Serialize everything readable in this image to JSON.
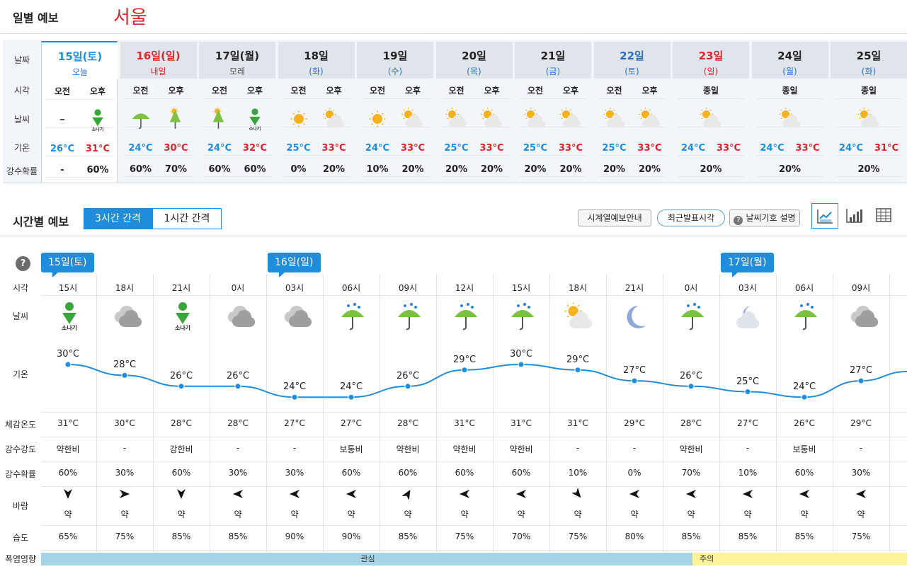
{
  "daily": {
    "title": "일별 예보",
    "city": "서울",
    "row_labels": [
      "날짜",
      "시각",
      "날씨",
      "기온",
      "강수확률"
    ],
    "days": [
      {
        "date": "15일(토)",
        "sub": "오늘",
        "tone": "blue",
        "split": true,
        "times": [
          "오전",
          "오후"
        ],
        "icons": [
          "dash",
          "shower"
        ],
        "lo": "26°C",
        "hi": "31°C",
        "prob": [
          "-",
          "60%"
        ]
      },
      {
        "date": "16일(일)",
        "sub": "내일",
        "tone": "red",
        "split": true,
        "times": [
          "오전",
          "오후"
        ],
        "icons": [
          "umbrella",
          "umbrella-sun"
        ],
        "lo": "24°C",
        "hi": "30°C",
        "prob": [
          "60%",
          "70%"
        ]
      },
      {
        "date": "17일(월)",
        "sub": "모레",
        "tone": "normal",
        "split": true,
        "times": [
          "오전",
          "오후"
        ],
        "icons": [
          "umbrella-sun",
          "shower"
        ],
        "lo": "24°C",
        "hi": "32°C",
        "prob": [
          "60%",
          "60%"
        ]
      },
      {
        "date": "18일",
        "sub": "(화)",
        "tone": "normal",
        "split": true,
        "times": [
          "오전",
          "오후"
        ],
        "icons": [
          "sun",
          "sun-cloud"
        ],
        "lo": "25°C",
        "hi": "33°C",
        "prob": [
          "0%",
          "20%"
        ]
      },
      {
        "date": "19일",
        "sub": "(수)",
        "tone": "normal",
        "split": true,
        "times": [
          "오전",
          "오후"
        ],
        "icons": [
          "sun",
          "sun-cloud"
        ],
        "lo": "24°C",
        "hi": "33°C",
        "prob": [
          "10%",
          "20%"
        ]
      },
      {
        "date": "20일",
        "sub": "(목)",
        "tone": "normal",
        "split": true,
        "times": [
          "오전",
          "오후"
        ],
        "icons": [
          "sun-cloud",
          "sun-cloud"
        ],
        "lo": "25°C",
        "hi": "33°C",
        "prob": [
          "20%",
          "20%"
        ]
      },
      {
        "date": "21일",
        "sub": "(금)",
        "tone": "normal",
        "split": true,
        "times": [
          "오전",
          "오후"
        ],
        "icons": [
          "sun-cloud",
          "sun-cloud"
        ],
        "lo": "25°C",
        "hi": "33°C",
        "prob": [
          "20%",
          "20%"
        ]
      },
      {
        "date": "22일",
        "sub": "(토)",
        "tone": "blue",
        "split": true,
        "times": [
          "오전",
          "오후"
        ],
        "icons": [
          "sun-cloud",
          "sun-cloud"
        ],
        "lo": "25°C",
        "hi": "33°C",
        "prob": [
          "20%",
          "20%"
        ]
      },
      {
        "date": "23일",
        "sub": "(일)",
        "tone": "red",
        "split": false,
        "times": [
          "종일"
        ],
        "icons": [
          "sun-cloud"
        ],
        "lo": "24°C",
        "hi": "33°C",
        "prob": [
          "20%"
        ]
      },
      {
        "date": "24일",
        "sub": "(월)",
        "tone": "normal",
        "split": false,
        "times": [
          "종일"
        ],
        "icons": [
          "sun-cloud"
        ],
        "lo": "24°C",
        "hi": "33°C",
        "prob": [
          "20%"
        ]
      },
      {
        "date": "25일",
        "sub": "(화)",
        "tone": "normal",
        "split": false,
        "times": [
          "종일"
        ],
        "icons": [
          "sun-cloud"
        ],
        "lo": "24°C",
        "hi": "31°C",
        "prob": [
          "20%"
        ]
      }
    ]
  },
  "hourly": {
    "title": "시간별 예보",
    "tabs": [
      "3시간 간격",
      "1시간 간격"
    ],
    "buttons": [
      "시계열예보안내",
      "최근발표시각",
      "날씨기호 설명"
    ],
    "help": "?",
    "view_icons": [
      "line-chart-icon",
      "bar-chart-icon",
      "table-icon"
    ],
    "row_labels": [
      "시각",
      "날씨",
      "기온",
      "체감온도",
      "강수강도",
      "강수확률",
      "바람",
      "습도",
      "폭염영향"
    ],
    "date_flags": [
      {
        "label": "15일(토)",
        "col": 0
      },
      {
        "label": "16일(일)",
        "col": 4
      },
      {
        "label": "17일(월)",
        "col": 12
      }
    ],
    "shower_text": "소나기",
    "columns": [
      {
        "time": "15시",
        "icon": "shower",
        "temp": 30,
        "feels": "31°C",
        "intensity": "약한비",
        "prob": "60%",
        "wind_deg": 180,
        "wind": "약",
        "humidity": "65%"
      },
      {
        "time": "18시",
        "icon": "cloud",
        "temp": 28,
        "feels": "30°C",
        "intensity": "-",
        "prob": "30%",
        "wind_deg": 90,
        "wind": "약",
        "humidity": "75%"
      },
      {
        "time": "21시",
        "icon": "shower",
        "temp": 26,
        "feels": "28°C",
        "intensity": "강한비",
        "prob": "60%",
        "wind_deg": 180,
        "wind": "약",
        "humidity": "85%"
      },
      {
        "time": "0시",
        "icon": "cloud",
        "temp": 26,
        "feels": "28°C",
        "intensity": "-",
        "prob": "30%",
        "wind_deg": 270,
        "wind": "약",
        "humidity": "85%"
      },
      {
        "time": "03시",
        "icon": "cloud",
        "temp": 24,
        "feels": "27°C",
        "intensity": "-",
        "prob": "30%",
        "wind_deg": 270,
        "wind": "약",
        "humidity": "90%"
      },
      {
        "time": "06시",
        "icon": "rain-umbrella",
        "temp": 24,
        "feels": "27°C",
        "intensity": "보통비",
        "prob": "60%",
        "wind_deg": 270,
        "wind": "약",
        "humidity": "90%"
      },
      {
        "time": "09시",
        "icon": "rain-umbrella",
        "temp": 26,
        "feels": "28°C",
        "intensity": "약한비",
        "prob": "60%",
        "wind_deg": 30,
        "wind": "약",
        "humidity": "85%"
      },
      {
        "time": "12시",
        "icon": "rain-umbrella",
        "temp": 29,
        "feels": "31°C",
        "intensity": "약한비",
        "prob": "60%",
        "wind_deg": 270,
        "wind": "약",
        "humidity": "75%"
      },
      {
        "time": "15시",
        "icon": "rain-umbrella",
        "temp": 30,
        "feels": "31°C",
        "intensity": "약한비",
        "prob": "60%",
        "wind_deg": 270,
        "wind": "약",
        "humidity": "70%"
      },
      {
        "time": "18시",
        "icon": "sun-cloud",
        "temp": 29,
        "feels": "31°C",
        "intensity": "-",
        "prob": "10%",
        "wind_deg": 140,
        "wind": "약",
        "humidity": "75%"
      },
      {
        "time": "21시",
        "icon": "moon",
        "temp": 27,
        "feels": "29°C",
        "intensity": "-",
        "prob": "0%",
        "wind_deg": 270,
        "wind": "약",
        "humidity": "80%"
      },
      {
        "time": "0시",
        "icon": "rain-umbrella",
        "temp": 26,
        "feels": "28°C",
        "intensity": "약한비",
        "prob": "70%",
        "wind_deg": 270,
        "wind": "약",
        "humidity": "85%"
      },
      {
        "time": "03시",
        "icon": "moon-cloud",
        "temp": 25,
        "feels": "27°C",
        "intensity": "-",
        "prob": "10%",
        "wind_deg": 270,
        "wind": "약",
        "humidity": "85%"
      },
      {
        "time": "06시",
        "icon": "rain-umbrella",
        "temp": 24,
        "feels": "26°C",
        "intensity": "보통비",
        "prob": "60%",
        "wind_deg": 270,
        "wind": "약",
        "humidity": "85%"
      },
      {
        "time": "09시",
        "icon": "cloud",
        "temp": 27,
        "feels": "29°C",
        "intensity": "-",
        "prob": "30%",
        "wind_deg": 270,
        "wind": "약",
        "humidity": "75%"
      }
    ],
    "heat": [
      {
        "label": "관심",
        "from_col": 0,
        "to_col": 11.5,
        "color": "#a6d4e6"
      },
      {
        "label": "주의",
        "from_col": 11.5,
        "to_col": 15.5,
        "color": "#fbf29a"
      }
    ]
  },
  "colors": {
    "accent": "#1f8ddb",
    "red": "#d9252a",
    "line": "#1f8ddb"
  }
}
